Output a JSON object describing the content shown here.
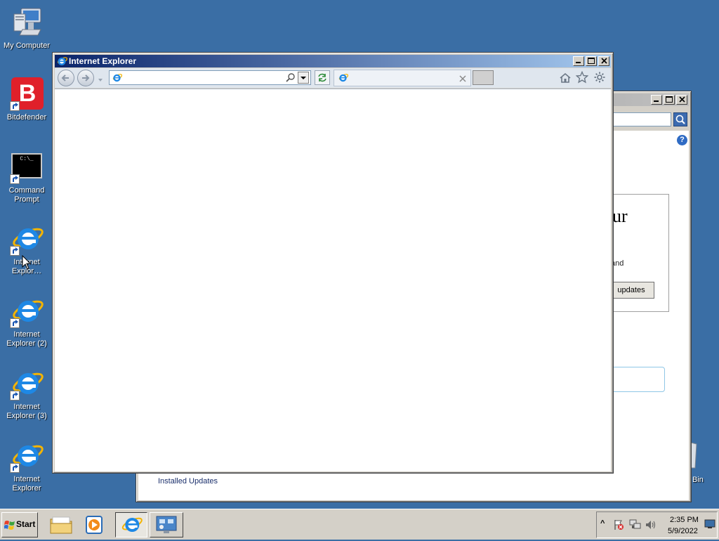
{
  "desktop": {
    "icons": [
      {
        "label": "My Computer",
        "icon": "computer-icon"
      },
      {
        "label": "Bitdefender",
        "icon": "bitdefender-icon"
      },
      {
        "label": "Command Prompt",
        "icon": "cmd-icon"
      },
      {
        "label": "Internet Explor…",
        "icon": "ie-icon"
      },
      {
        "label": "Internet Explorer (2)",
        "icon": "ie-icon"
      },
      {
        "label": "Internet Explorer (3)",
        "icon": "ie-icon"
      },
      {
        "label": "Internet Explorer",
        "icon": "ie-icon"
      },
      {
        "label": "Bin",
        "icon": "recycle-bin-icon"
      }
    ],
    "background_color": "#3a6ea5"
  },
  "ie_window": {
    "title": "Internet Explorer",
    "address_value": "",
    "tab_title": "",
    "bitdefender_glyph": "B"
  },
  "background_window": {
    "heading_fragment": "ur",
    "text_fragment": "and",
    "button_label": "updates",
    "footer_link": "Installed Updates",
    "help_glyph": "?"
  },
  "taskbar": {
    "start_label": "Start",
    "clock_time": "2:35 PM",
    "clock_date": "5/9/2022",
    "tray_expand": "^"
  },
  "colors": {
    "title_active": "#0a246a",
    "title_active_end": "#a6caf0",
    "window_face": "#d4d0c8",
    "ie_blue": "#1e88e5",
    "ie_gold": "#f4b400",
    "bitdefender_red": "#e0202a"
  }
}
